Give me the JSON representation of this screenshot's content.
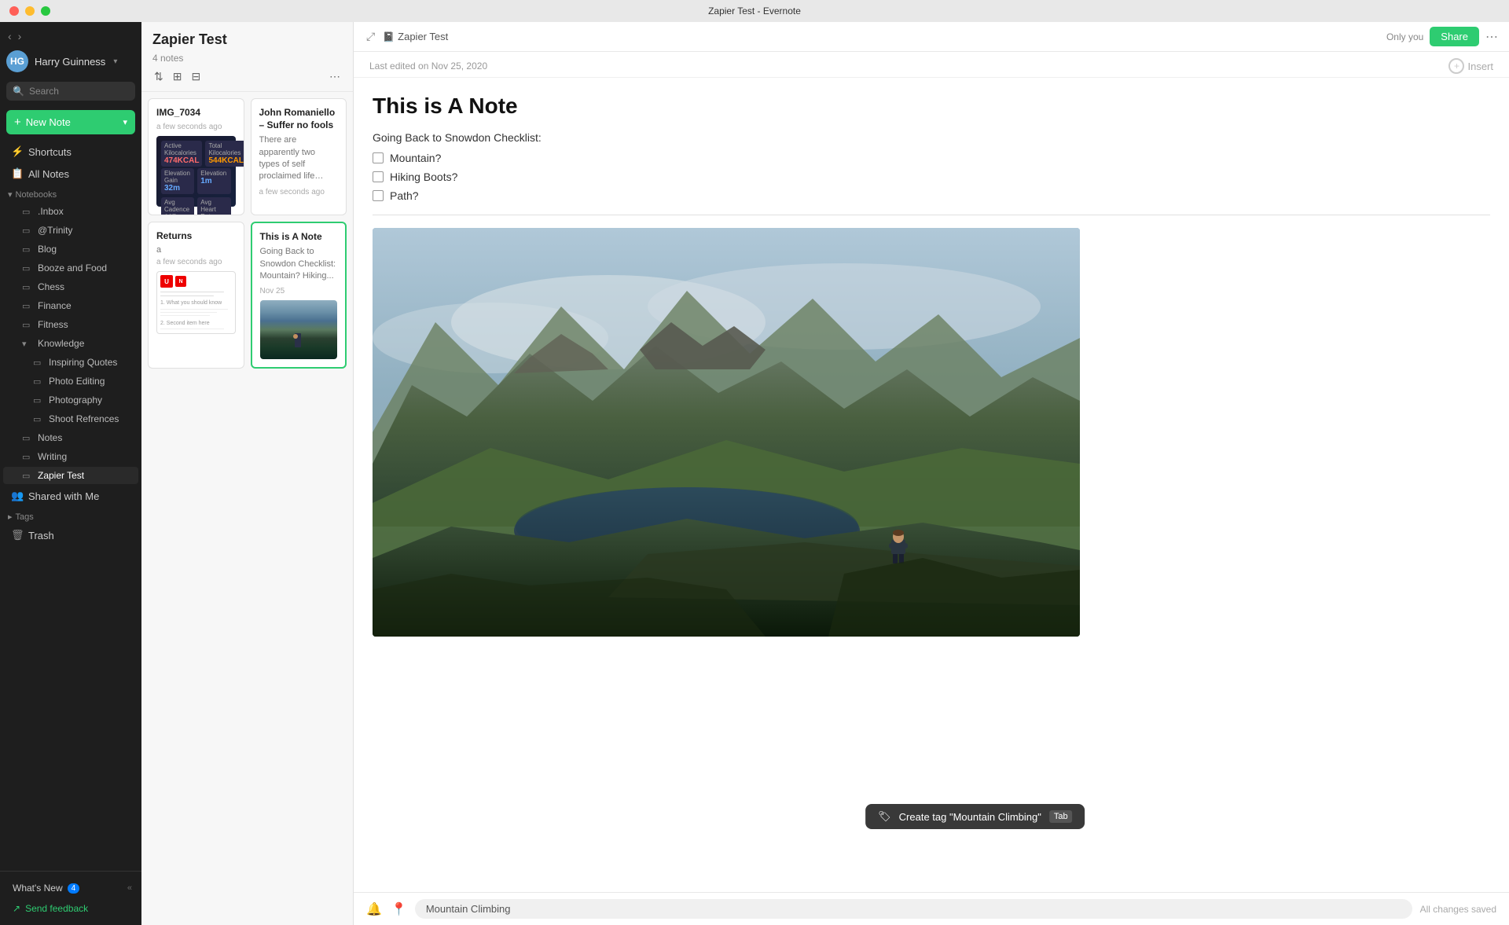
{
  "window": {
    "title": "Zapier Test - Evernote"
  },
  "titlebar": {
    "title": "Zapier Test - Evernote"
  },
  "sidebar": {
    "user": {
      "name": "Harry Guinness",
      "initials": "HG"
    },
    "search_placeholder": "Search",
    "new_note_label": "New Note",
    "items": [
      {
        "id": "shortcuts",
        "label": "Shortcuts",
        "icon": "⚡"
      },
      {
        "id": "all-notes",
        "label": "All Notes",
        "icon": "📋"
      }
    ],
    "notebooks_label": "Notebooks",
    "notebooks": [
      {
        "id": "inbox",
        "label": ".Inbox",
        "indent": 1
      },
      {
        "id": "trinity",
        "label": "@Trinity",
        "indent": 1
      },
      {
        "id": "blog",
        "label": "Blog",
        "indent": 1
      },
      {
        "id": "booze-food",
        "label": "Booze and Food",
        "indent": 1
      },
      {
        "id": "chess",
        "label": "Chess",
        "indent": 1
      },
      {
        "id": "finance",
        "label": "Finance",
        "indent": 1
      },
      {
        "id": "fitness",
        "label": "Fitness",
        "indent": 1
      },
      {
        "id": "knowledge",
        "label": "Knowledge",
        "indent": 1,
        "expanded": true
      },
      {
        "id": "inspiring-quotes",
        "label": "Inspiring Quotes",
        "indent": 2
      },
      {
        "id": "photo-editing",
        "label": "Photo Editing",
        "indent": 2
      },
      {
        "id": "photography",
        "label": "Photography",
        "indent": 2
      },
      {
        "id": "shoot-references",
        "label": "Shoot Refrences",
        "indent": 2
      },
      {
        "id": "notes",
        "label": "Notes",
        "indent": 1
      },
      {
        "id": "writing",
        "label": "Writing",
        "indent": 1
      },
      {
        "id": "zapier-test",
        "label": "Zapier Test",
        "indent": 1,
        "active": true
      }
    ],
    "shared_with_me": "Shared with Me",
    "tags_label": "Tags",
    "trash_label": "Trash",
    "whats_new_label": "What's New",
    "whats_new_badge": "4",
    "feedback_label": "Send feedback"
  },
  "note_list": {
    "title": "Zapier Test",
    "count": "4 notes",
    "notes": [
      {
        "id": "img-7034",
        "title": "IMG_7034",
        "preview": "",
        "time": "a few seconds ago",
        "has_fitness_img": true
      },
      {
        "id": "john-romaniello",
        "title": "John Romaniello – Suffer no fools",
        "preview": "There are apparently two types of self proclaimed life gurus. The first tells you to live in the moment, put your cell phone down, experience your experi-...",
        "time": "a few seconds ago",
        "has_fitness_img": false
      },
      {
        "id": "returns",
        "title": "Returns",
        "preview": "a",
        "time": "a few seconds ago",
        "has_returns_img": true
      },
      {
        "id": "this-is-a-note",
        "title": "This is A Note",
        "preview": "Going Back to Snowdon Checklist: Mountain? Hiking...",
        "time": "Nov 25",
        "selected": true,
        "has_mountain_thumb": true
      }
    ]
  },
  "editor": {
    "breadcrumb_icon": "📓",
    "breadcrumb_notebook": "Zapier Test",
    "only_you": "Only you",
    "share_label": "Share",
    "insert_label": "Insert",
    "last_edited": "Last edited on Nov 25, 2020",
    "note_title": "This is A Note",
    "checklist_heading": "Going Back to Snowdon Checklist:",
    "checklist_items": [
      "Mountain?",
      "Hiking Boots?",
      "Path?"
    ],
    "tag_tooltip_text": "Create tag \"Mountain Climbing\"",
    "tag_tooltip_key": "Tab",
    "tag_input_value": "Mountain Climbing",
    "saved_status": "All changes saved"
  }
}
